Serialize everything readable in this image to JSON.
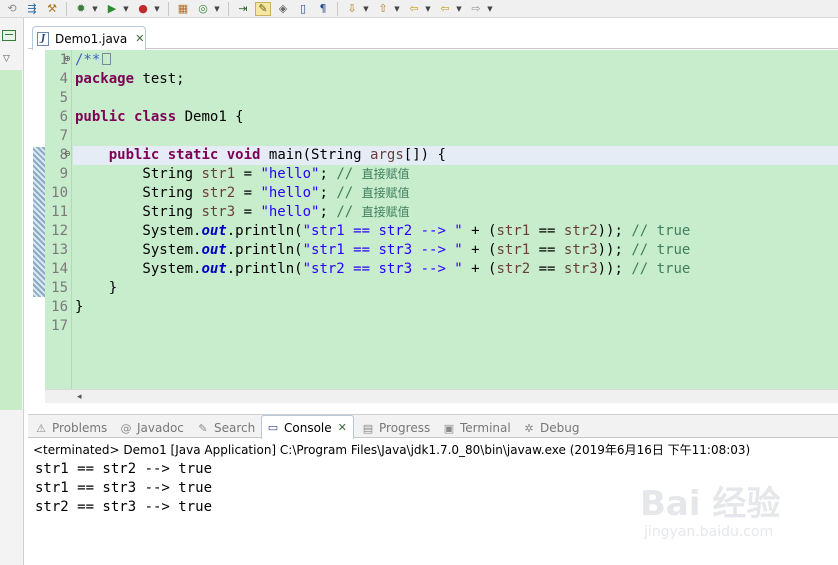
{
  "toolbar": {
    "icons": [
      "history-icon",
      "refactor-icon",
      "run-external-icon",
      "run-icon",
      "debug-icon",
      "package-icon",
      "new-class-icon",
      "next-annotation-icon",
      "highlight-icon",
      "prev-annotation-icon",
      "pin-icon",
      "open-type-icon",
      "search-icon",
      "back-icon",
      "forward-icon",
      "nav-arrow-icon"
    ]
  },
  "editor": {
    "tab": {
      "file_name": "Demo1.java",
      "icon": "java-file-icon",
      "close": "✕"
    },
    "lines": [
      {
        "num": "1",
        "folded": true,
        "tokens": [
          {
            "t": "/**",
            "c": "jdoc"
          }
        ]
      },
      {
        "num": "4",
        "tokens": [
          {
            "t": "package",
            "c": "kw"
          },
          {
            "t": " test;",
            "c": ""
          }
        ]
      },
      {
        "num": "5",
        "tokens": []
      },
      {
        "num": "6",
        "tokens": [
          {
            "t": "public",
            "c": "kw"
          },
          {
            "t": " ",
            "c": ""
          },
          {
            "t": "class",
            "c": "kw"
          },
          {
            "t": " Demo1 {",
            "c": ""
          }
        ]
      },
      {
        "num": "7",
        "tokens": []
      },
      {
        "num": "8",
        "fold_marker": true,
        "tokens": [
          {
            "t": "    ",
            "c": ""
          },
          {
            "t": "public",
            "c": "kw"
          },
          {
            "t": " ",
            "c": ""
          },
          {
            "t": "static",
            "c": "kw"
          },
          {
            "t": " ",
            "c": ""
          },
          {
            "t": "void",
            "c": "kw"
          },
          {
            "t": " main(String ",
            "c": ""
          },
          {
            "t": "args",
            "c": "var"
          },
          {
            "t": "[]) {",
            "c": ""
          }
        ]
      },
      {
        "num": "9",
        "tokens": [
          {
            "t": "        String ",
            "c": ""
          },
          {
            "t": "str1",
            "c": "var"
          },
          {
            "t": " = ",
            "c": ""
          },
          {
            "t": "\"hello\"",
            "c": "str"
          },
          {
            "t": "; ",
            "c": ""
          },
          {
            "t": "// ",
            "c": "cmt"
          },
          {
            "t": "直接赋值",
            "c": "cn"
          }
        ]
      },
      {
        "num": "10",
        "tokens": [
          {
            "t": "        String ",
            "c": ""
          },
          {
            "t": "str2",
            "c": "var"
          },
          {
            "t": " = ",
            "c": ""
          },
          {
            "t": "\"hello\"",
            "c": "str"
          },
          {
            "t": "; ",
            "c": ""
          },
          {
            "t": "// ",
            "c": "cmt"
          },
          {
            "t": "直接赋值",
            "c": "cn"
          }
        ]
      },
      {
        "num": "11",
        "tokens": [
          {
            "t": "        String ",
            "c": ""
          },
          {
            "t": "str3",
            "c": "var"
          },
          {
            "t": " = ",
            "c": ""
          },
          {
            "t": "\"hello\"",
            "c": "str"
          },
          {
            "t": "; ",
            "c": ""
          },
          {
            "t": "// ",
            "c": "cmt"
          },
          {
            "t": "直接赋值",
            "c": "cn"
          }
        ]
      },
      {
        "num": "12",
        "tokens": [
          {
            "t": "        System.",
            "c": ""
          },
          {
            "t": "out",
            "c": "fld"
          },
          {
            "t": ".println(",
            "c": ""
          },
          {
            "t": "\"str1 == str2 --> \"",
            "c": "str"
          },
          {
            "t": " + (",
            "c": ""
          },
          {
            "t": "str1",
            "c": "var"
          },
          {
            "t": " == ",
            "c": ""
          },
          {
            "t": "str2",
            "c": "var"
          },
          {
            "t": ")); ",
            "c": ""
          },
          {
            "t": "// true",
            "c": "cmt"
          }
        ]
      },
      {
        "num": "13",
        "tokens": [
          {
            "t": "        System.",
            "c": ""
          },
          {
            "t": "out",
            "c": "fld"
          },
          {
            "t": ".println(",
            "c": ""
          },
          {
            "t": "\"str1 == str3 --> \"",
            "c": "str"
          },
          {
            "t": " + (",
            "c": ""
          },
          {
            "t": "str1",
            "c": "var"
          },
          {
            "t": " == ",
            "c": ""
          },
          {
            "t": "str3",
            "c": "var"
          },
          {
            "t": ")); ",
            "c": ""
          },
          {
            "t": "// true",
            "c": "cmt"
          }
        ]
      },
      {
        "num": "14",
        "tokens": [
          {
            "t": "        System.",
            "c": ""
          },
          {
            "t": "out",
            "c": "fld"
          },
          {
            "t": ".println(",
            "c": ""
          },
          {
            "t": "\"str2 == str3 --> \"",
            "c": "str"
          },
          {
            "t": " + (",
            "c": ""
          },
          {
            "t": "str2",
            "c": "var"
          },
          {
            "t": " == ",
            "c": ""
          },
          {
            "t": "str3",
            "c": "var"
          },
          {
            "t": ")); ",
            "c": ""
          },
          {
            "t": "// true",
            "c": "cmt"
          }
        ]
      },
      {
        "num": "15",
        "tokens": [
          {
            "t": "    }",
            "c": ""
          }
        ]
      },
      {
        "num": "16",
        "tokens": [
          {
            "t": "}",
            "c": ""
          }
        ]
      },
      {
        "num": "17",
        "tokens": []
      }
    ]
  },
  "panel": {
    "tabs": [
      {
        "label": "Problems",
        "icon": "problems-icon",
        "glyph": "⚠",
        "active": false
      },
      {
        "label": "Javadoc",
        "icon": "javadoc-icon",
        "glyph": "@",
        "active": false
      },
      {
        "label": "Search",
        "icon": "search-icon",
        "glyph": "✎",
        "active": false
      },
      {
        "label": "Console",
        "icon": "console-icon",
        "glyph": "▭",
        "active": true
      },
      {
        "label": "Progress",
        "icon": "progress-icon",
        "glyph": "▤",
        "active": false
      },
      {
        "label": "Terminal",
        "icon": "terminal-icon",
        "glyph": "▣",
        "active": false
      },
      {
        "label": "Debug",
        "icon": "debug-icon",
        "glyph": "✲",
        "active": false
      }
    ],
    "console_close": "✕",
    "console_header": "<terminated> Demo1 [Java Application] C:\\Program Files\\Java\\jdk1.7.0_80\\bin\\javaw.exe (2019年6月16日 下午11:08:03)",
    "output": [
      "str1 == str2 --> true",
      "str1 == str3 --> true",
      "str2 == str3 --> true"
    ]
  },
  "watermark": {
    "brand": "Bai 经验",
    "url": "jingyan.baidu.com"
  }
}
